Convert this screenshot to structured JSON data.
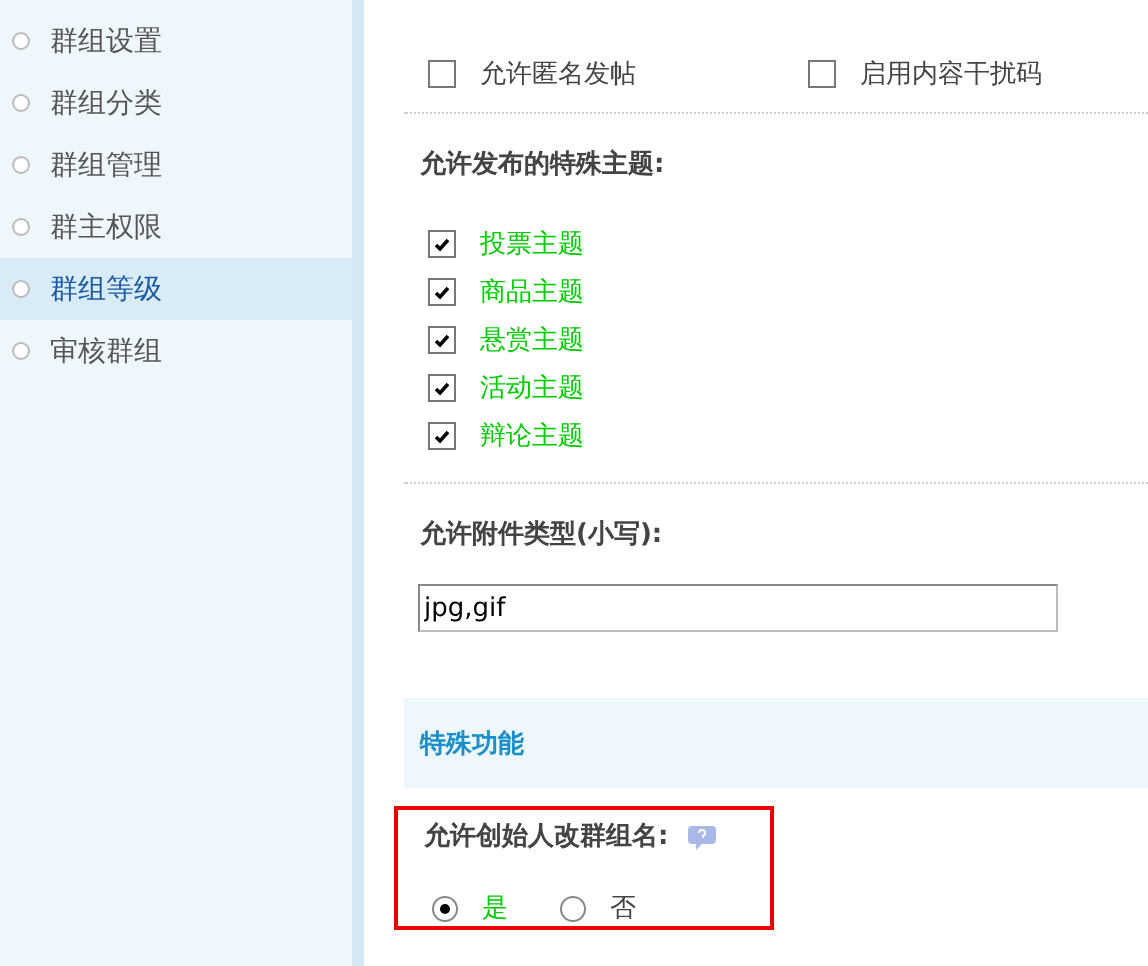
{
  "sidebar": {
    "items": [
      {
        "label": "群组设置",
        "selected": false
      },
      {
        "label": "群组分类",
        "selected": false
      },
      {
        "label": "群组管理",
        "selected": false
      },
      {
        "label": "群主权限",
        "selected": false
      },
      {
        "label": "群组等级",
        "selected": true
      },
      {
        "label": "审核群组",
        "selected": false
      }
    ]
  },
  "options": [
    {
      "label": "允许匿名发帖",
      "checked": false
    },
    {
      "label": "启用内容干扰码",
      "checked": false
    }
  ],
  "special_threads": {
    "heading": "允许发布的特殊主题:",
    "items": [
      {
        "label": "投票主题",
        "checked": true
      },
      {
        "label": "商品主题",
        "checked": true
      },
      {
        "label": "悬赏主题",
        "checked": true
      },
      {
        "label": "活动主题",
        "checked": true
      },
      {
        "label": "辩论主题",
        "checked": true
      }
    ]
  },
  "attachments": {
    "heading": "允许附件类型(小写):",
    "value": "jpg,gif"
  },
  "section": {
    "title": "特殊功能"
  },
  "rename_setting": {
    "label": "允许创始人改群组名:",
    "highlighted": true,
    "choices": [
      {
        "label": "是",
        "selected": true
      },
      {
        "label": "否",
        "selected": false
      }
    ]
  }
}
